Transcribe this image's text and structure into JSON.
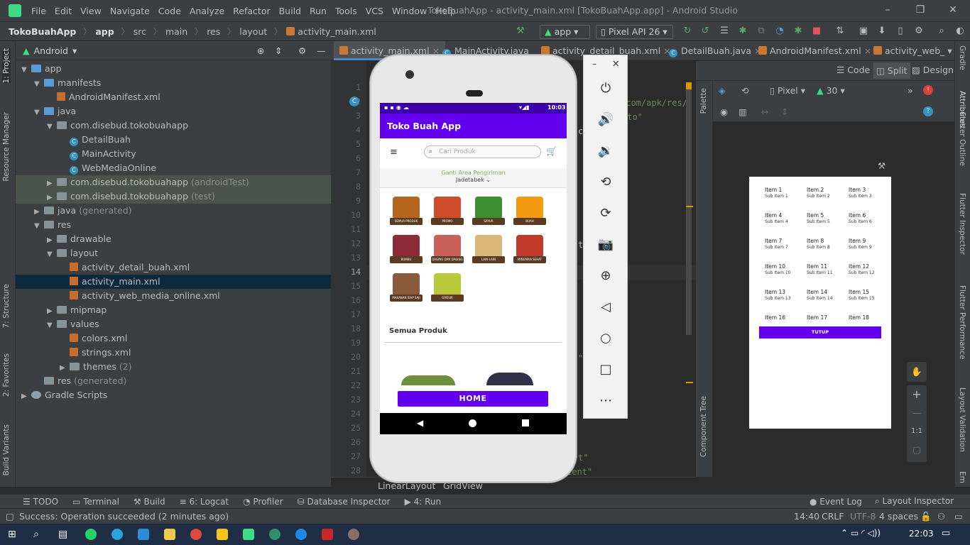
{
  "menubar": {
    "items": [
      "File",
      "Edit",
      "View",
      "Navigate",
      "Code",
      "Analyze",
      "Refactor",
      "Build",
      "Run",
      "Tools",
      "VCS",
      "Window",
      "Help"
    ],
    "title": "TokoBuahApp - activity_main.xml [TokoBuahApp.app] - Android Studio"
  },
  "breadcrumb": {
    "items": [
      "TokoBuahApp",
      "app",
      "src",
      "main",
      "res",
      "layout",
      "activity_main.xml"
    ],
    "run_config": "app",
    "device": "Pixel API 26"
  },
  "project": {
    "view_label": "Android",
    "tree": [
      {
        "label": "app",
        "level": 0,
        "type": "folder-blue",
        "open": true
      },
      {
        "label": "manifests",
        "level": 1,
        "type": "folder-blue",
        "open": true
      },
      {
        "label": "AndroidManifest.xml",
        "level": 2,
        "type": "xml"
      },
      {
        "label": "java",
        "level": 1,
        "type": "folder-blue",
        "open": true
      },
      {
        "label": "com.disebud.tokobuahapp",
        "level": 2,
        "type": "folder",
        "open": true
      },
      {
        "label": "DetailBuah",
        "level": 3,
        "type": "class"
      },
      {
        "label": "MainActivity",
        "level": 3,
        "type": "class"
      },
      {
        "label": "WebMediaOnline",
        "level": 3,
        "type": "class"
      },
      {
        "label": "com.disebud.tokobuahapp",
        "suffix": "(androidTest)",
        "level": 2,
        "type": "folder",
        "open": false,
        "hl": true
      },
      {
        "label": "com.disebud.tokobuahapp",
        "suffix": "(test)",
        "level": 2,
        "type": "folder",
        "open": false,
        "hl": true
      },
      {
        "label": "java",
        "suffix": "(generated)",
        "level": 1,
        "type": "folder",
        "open": false
      },
      {
        "label": "res",
        "level": 1,
        "type": "folder",
        "open": true
      },
      {
        "label": "drawable",
        "level": 2,
        "type": "folder",
        "open": false
      },
      {
        "label": "layout",
        "level": 2,
        "type": "folder",
        "open": true
      },
      {
        "label": "activity_detail_buah.xml",
        "level": 3,
        "type": "xml"
      },
      {
        "label": "activity_main.xml",
        "level": 3,
        "type": "xml",
        "sel": true
      },
      {
        "label": "activity_web_media_online.xml",
        "level": 3,
        "type": "xml"
      },
      {
        "label": "mipmap",
        "level": 2,
        "type": "folder",
        "open": false
      },
      {
        "label": "values",
        "level": 2,
        "type": "folder",
        "open": true
      },
      {
        "label": "colors.xml",
        "level": 3,
        "type": "xml"
      },
      {
        "label": "strings.xml",
        "level": 3,
        "type": "xml"
      },
      {
        "label": "themes",
        "suffix": "(2)",
        "level": 3,
        "type": "folder",
        "open": false
      },
      {
        "label": "res",
        "suffix": "(generated)",
        "level": 1,
        "type": "folder"
      },
      {
        "label": "Gradle Scripts",
        "level": 0,
        "type": "gradle",
        "open": false
      }
    ]
  },
  "left_tabs": [
    "1: Project",
    "Resource Manager",
    "7: Structure",
    "2: Favorites",
    "Build Variants"
  ],
  "right_tabs": [
    "Gradle",
    "Attributes",
    "Flutter Outline",
    "Flutter Inspector",
    "Flutter Performance",
    "Layout Validation",
    "Em"
  ],
  "editor_tabs": [
    "activity_main.xml",
    "MainActivity.java",
    "activity_detail_buah.xml",
    "DetailBuah.java",
    "AndroidManifest.xml",
    "activity_web_"
  ],
  "editor": {
    "line_numbers": [
      "1",
      "2",
      "3",
      "4",
      "5",
      "6",
      "7",
      "8",
      "9",
      "10",
      "11",
      "12",
      "13",
      "14",
      "15",
      "16",
      "17",
      "18",
      "19",
      "20",
      "21",
      "22",
      "23",
      "24",
      "25",
      "26",
      "27",
      "28"
    ],
    "visible_code": [
      ".com/apk/res/",
      "uto\"",
      "c",
      "t",
      "t",
      "\"",
      "t\"",
      "cent\""
    ],
    "breadcrumb": [
      "LinearLayout",
      "GridView"
    ]
  },
  "design": {
    "modes": [
      "Code",
      "Split",
      "Design"
    ],
    "palette_label": "Palette",
    "component_tree_label": "Component Tree",
    "device": "Pixel",
    "api": "30",
    "zoom_label": "1:1",
    "grid_items": [
      {
        "t": "Item 1",
        "s": "Sub Item 1"
      },
      {
        "t": "Item 2",
        "s": "Sub Item 2"
      },
      {
        "t": "Item 3",
        "s": "Sub Item 3"
      },
      {
        "t": "Item 4",
        "s": "Sub Item 4"
      },
      {
        "t": "Item 5",
        "s": "Sub Item 5"
      },
      {
        "t": "Item 6",
        "s": "Sub Item 6"
      },
      {
        "t": "Item 7",
        "s": "Sub Item 7"
      },
      {
        "t": "Item 8",
        "s": "Sub Item 8"
      },
      {
        "t": "Item 9",
        "s": "Sub Item 9"
      },
      {
        "t": "Item 10",
        "s": "Sub Item 10"
      },
      {
        "t": "Item 11",
        "s": "Sub Item 11"
      },
      {
        "t": "Item 12",
        "s": "Sub Item 12"
      },
      {
        "t": "Item 13",
        "s": "Sub Item 13"
      },
      {
        "t": "Item 14",
        "s": "Sub Item 14"
      },
      {
        "t": "Item 15",
        "s": "Sub Item 15"
      },
      {
        "t": "Item 16",
        "s": ""
      },
      {
        "t": "Item 17",
        "s": ""
      },
      {
        "t": "Item 18",
        "s": ""
      }
    ],
    "button_label": "TUTUP"
  },
  "emulator": {
    "clock": "10:03",
    "app_title": "Toko Buah App",
    "search_placeholder": "Cari Produk",
    "ship_label": "Ganti Area Pengiriman",
    "ship_region": "Jadetabek",
    "categories": [
      {
        "label": "SEMUA PRODUK",
        "color": "#b5651d"
      },
      {
        "label": "PROMO",
        "color": "#d04b2a"
      },
      {
        "label": "SAYUR",
        "color": "#3c8f2e"
      },
      {
        "label": "BUAH",
        "color": "#f39c12"
      },
      {
        "label": "BUMBU",
        "color": "#8e2b3a"
      },
      {
        "label": "DAGING DAN DAGING",
        "color": "#c9615a"
      },
      {
        "label": "LAIN-LAIN",
        "color": "#d9b77a"
      },
      {
        "label": "MINUMAN SEHAT",
        "color": "#c0392b"
      },
      {
        "label": "MAKANAN SIAP SAJI",
        "color": "#8a5a3a"
      },
      {
        "label": "GROSIR",
        "color": "#b8c93a"
      }
    ],
    "section_title": "Semua Produk",
    "home_label": "HOME"
  },
  "bottom_tabs": [
    "TODO",
    "Terminal",
    "Build",
    "6: Logcat",
    "Profiler",
    "Database Inspector",
    "4: Run",
    "Event Log",
    "Layout Inspector"
  ],
  "status": {
    "message": "Success: Operation succeeded (2 minutes ago)",
    "position": "14:40",
    "line_sep": "CRLF",
    "encoding": "UTF-8",
    "indent": "4 spaces"
  },
  "taskbar": {
    "time": "22:03"
  }
}
